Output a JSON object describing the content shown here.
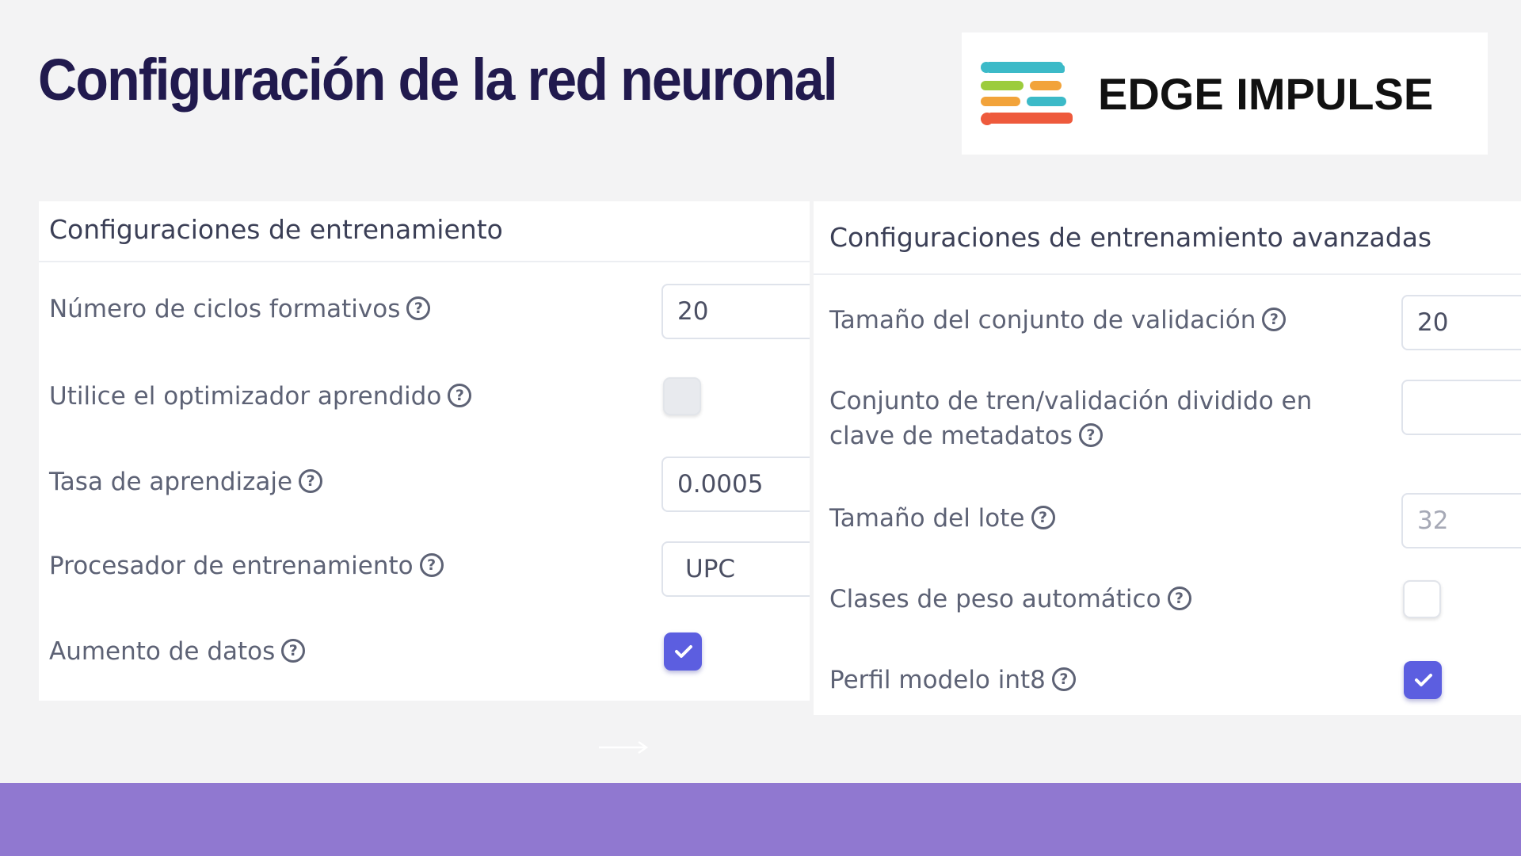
{
  "title": "Configuración de la red neuronal",
  "logo": {
    "text": "EDGE IMPULSE",
    "icon": "edge-impulse-logo"
  },
  "training_settings": {
    "header": "Configuraciones de entrenamiento",
    "epochs": {
      "label": "Número de ciclos formativos",
      "value": "20"
    },
    "learned_optimizer": {
      "label": "Utilice el optimizador aprendido",
      "checked": false
    },
    "learning_rate": {
      "label": "Tasa de aprendizaje",
      "value": "0.0005"
    },
    "processor": {
      "label": "Procesador de entrenamiento",
      "value": "UPC"
    },
    "data_augmentation": {
      "label": "Aumento de datos",
      "checked": true
    }
  },
  "advanced_settings": {
    "header": "Configuraciones de entrenamiento avanzadas",
    "validation_size": {
      "label": "Tamaño del conjunto de validación",
      "value": "20"
    },
    "split_key": {
      "label": "Conjunto de tren/validación dividido en clave de metadatos",
      "value": ""
    },
    "batch_size": {
      "label": "Tamaño del lote",
      "placeholder": "32"
    },
    "auto_weight": {
      "label": "Clases de peso automático",
      "checked": false
    },
    "int8_profile": {
      "label": "Perfil modelo int8",
      "checked": true
    }
  },
  "colors": {
    "title": "#211a4e",
    "accent": "#5c5ee0",
    "band": "#9078d0",
    "logo_teal": "#3cbac8",
    "logo_green": "#9ccc3c",
    "logo_orange": "#f2a33a",
    "logo_red": "#ee5a3c"
  }
}
